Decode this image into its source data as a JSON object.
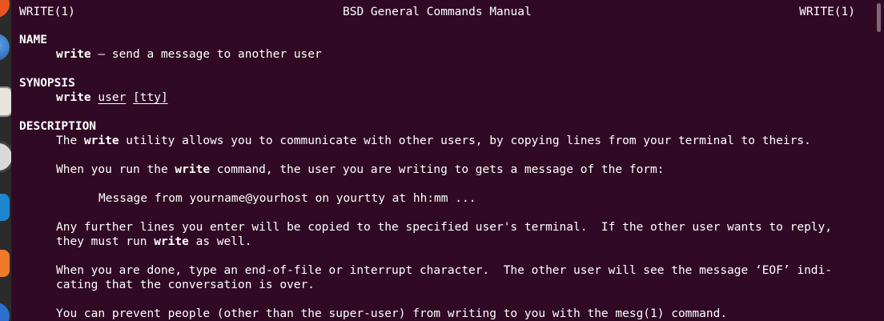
{
  "header": {
    "left": "WRITE(1)",
    "center": "BSD General Commands Manual",
    "right": "WRITE(1)"
  },
  "name_section": {
    "title": "NAME",
    "cmd": "write",
    "desc": " – send a message to another user"
  },
  "synopsis_section": {
    "title": "SYNOPSIS",
    "cmd": "write",
    "arg_user": "user",
    "arg_tty_open": "[",
    "arg_tty": "tty",
    "arg_tty_close": "]"
  },
  "description_section": {
    "title": "DESCRIPTION",
    "p1_pre": "The ",
    "p1_bold": "write",
    "p1_post": " utility allows you to communicate with other users, by copying lines from your terminal to theirs.",
    "p2_pre": "When you run the ",
    "p2_bold": "write",
    "p2_post": " command, the user you are writing to gets a message of the form:",
    "p3": "Message from yourname@yourhost on yourtty at hh:mm ...",
    "p4_line1": "Any further lines you enter will be copied to the specified user's terminal.  If the other user wants to reply,",
    "p4_line2_pre": "they must run ",
    "p4_line2_bold": "write",
    "p4_line2_post": " as well.",
    "p5_line1": "When you are done, type an end-of-file or interrupt character.  The other user will see the message ‘EOF’ indi-",
    "p5_line2": "cating that the conversation is over.",
    "p6": "You can prevent people (other than the super-user) from writing to you with the mesg(1) command."
  },
  "colors": {
    "background": "#300a24",
    "text": "#ffffff"
  }
}
